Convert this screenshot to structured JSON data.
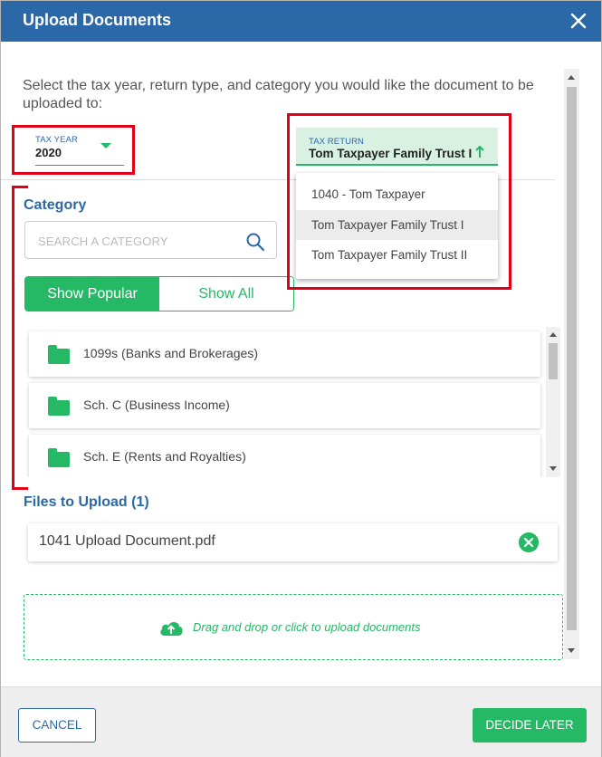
{
  "dialog": {
    "title": "Upload Documents",
    "close_icon": "close-icon"
  },
  "intro": "Select the tax year, return type, and category you would like the document to be uploaded to:",
  "tax_year": {
    "label": "TAX YEAR",
    "value": "2020",
    "icon": "caret-down-icon"
  },
  "tax_return": {
    "label": "TAX RETURN",
    "value": "Tom Taxpayer Family Trust I",
    "icon": "arrow-up-icon",
    "options": [
      "1040 - Tom Taxpayer",
      "Tom Taxpayer Family Trust I",
      "Tom Taxpayer Family Trust II"
    ],
    "selected_index": 1
  },
  "category": {
    "title": "Category",
    "search_placeholder": "SEARCH A CATEGORY",
    "search_icon": "search-icon",
    "toggle": {
      "popular": "Show Popular",
      "all": "Show All",
      "active": "popular"
    },
    "items": [
      {
        "label": "1099s (Banks and Brokerages)",
        "icon": "folder-icon"
      },
      {
        "label": "Sch. C (Business Income)",
        "icon": "folder-icon"
      },
      {
        "label": "Sch. E (Rents and Royalties)",
        "icon": "folder-icon"
      }
    ]
  },
  "files": {
    "title": "Files to Upload (1)",
    "items": [
      {
        "name": "1041 Upload Document.pdf",
        "remove_icon": "remove-icon"
      }
    ]
  },
  "dropzone": {
    "text": "Drag and drop or click to upload documents",
    "icon": "cloud-upload-icon"
  },
  "footer": {
    "cancel": "CANCEL",
    "decide_later": "DECIDE LATER"
  },
  "colors": {
    "header": "#2b68a8",
    "accent": "#25b865",
    "highlight": "#e0001a"
  }
}
